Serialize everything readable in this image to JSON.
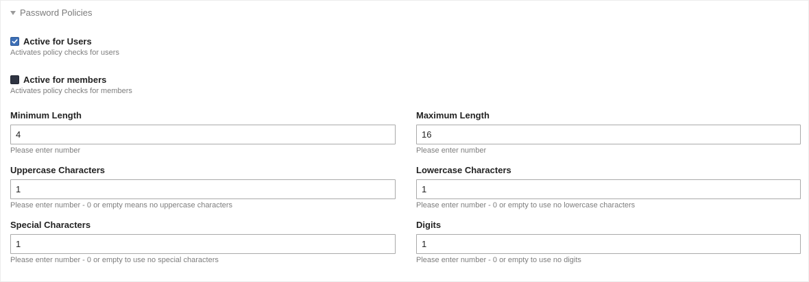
{
  "section": {
    "title": "Password Policies"
  },
  "toggles": [
    {
      "label": "Active for Users",
      "checked": true,
      "help": "Activates policy checks for users"
    },
    {
      "label": "Active for members",
      "checked": false,
      "help": "Activates policy checks for members"
    }
  ],
  "fields": {
    "minimum_length": {
      "label": "Minimum Length",
      "value": "4",
      "help": "Please enter number"
    },
    "maximum_length": {
      "label": "Maximum Length",
      "value": "16",
      "help": "Please enter number"
    },
    "uppercase": {
      "label": "Uppercase Characters",
      "value": "1",
      "help": "Please enter number - 0 or empty means no uppercase characters"
    },
    "lowercase": {
      "label": "Lowercase Characters",
      "value": "1",
      "help": "Please enter number - 0 or empty to use no lowercase characters"
    },
    "special": {
      "label": "Special Characters",
      "value": "1",
      "help": "Please enter number - 0 or empty to use no special characters"
    },
    "digits": {
      "label": "Digits",
      "value": "1",
      "help": "Please enter number - 0 or empty to use no digits"
    }
  },
  "colors": {
    "checkbox_checked": "#3d6fb6",
    "checkbox_unchecked": "#2f3442"
  }
}
